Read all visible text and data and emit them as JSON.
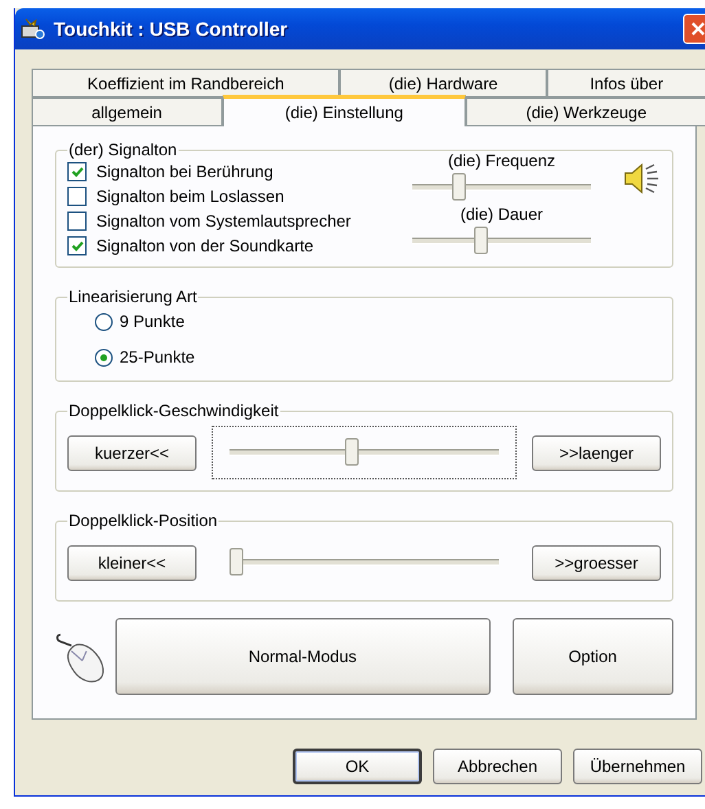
{
  "window": {
    "title": "Touchkit : USB Controller"
  },
  "tab_rows": [
    [
      {
        "label": "Koeffizient im Randbereich",
        "selected": false
      },
      {
        "label": "(die) Hardware",
        "selected": false
      },
      {
        "label": "Infos über",
        "selected": false
      }
    ],
    [
      {
        "label": "allgemein",
        "selected": false
      },
      {
        "label": "(die) Einstellung",
        "selected": true
      },
      {
        "label": "(die) Werkzeuge",
        "selected": false
      }
    ]
  ],
  "signal_group": {
    "title": "(der) Signalton",
    "checkboxes": [
      {
        "label": "Signalton bei Berührung",
        "checked": true
      },
      {
        "label": "Signalton beim Loslassen",
        "checked": false
      },
      {
        "label": "Signalton vom Systemlautsprecher",
        "checked": false
      },
      {
        "label": "Signalton von der Soundkarte",
        "checked": true
      }
    ],
    "sliders": [
      {
        "label": "(die) Frequenz",
        "level": 0.25
      },
      {
        "label": "(die) Dauer",
        "level": 0.38
      }
    ]
  },
  "linearization_group": {
    "title": "Linearisierung Art",
    "options": [
      {
        "label": "9 Punkte",
        "selected": false
      },
      {
        "label": "25-Punkte",
        "selected": true
      }
    ]
  },
  "slider_groups": [
    {
      "title": "Doppelklick-Geschwindigkeit",
      "left_button": "kuerzer<<",
      "right_button": ">>laenger",
      "level": 0.45,
      "focused": true
    },
    {
      "title": "Doppelklick-Position",
      "left_button": "kleiner<<",
      "right_button": ">>groesser",
      "level": 0.02,
      "focused": false
    }
  ],
  "mode_button": "Normal-Modus",
  "option_button": "Option",
  "buttons": [
    {
      "label": "OK",
      "default": true
    },
    {
      "label": "Abbrechen",
      "default": false
    },
    {
      "label": "Übernehmen",
      "default": false
    }
  ]
}
